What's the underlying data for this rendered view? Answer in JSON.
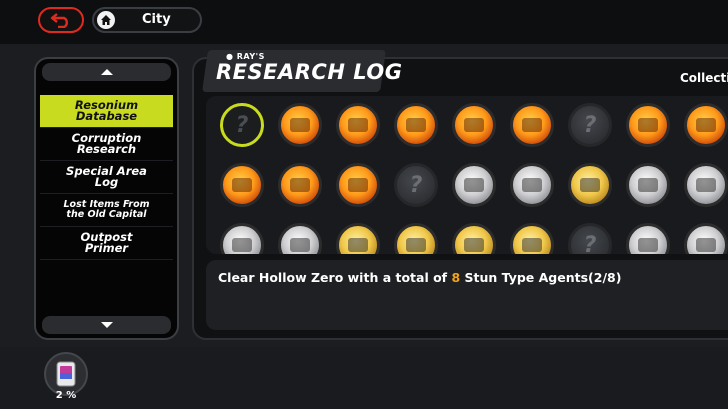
{
  "header": {
    "back_icon": "back-arrow-icon",
    "home_icon": "home-icon",
    "location": "City"
  },
  "sidebar": {
    "items": [
      {
        "label_line1": "Resonium",
        "label_line2": "Database",
        "active": true
      },
      {
        "label_line1": "Corruption",
        "label_line2": "Research",
        "active": false
      },
      {
        "label_line1": "Special Area",
        "label_line2": "Log",
        "active": false
      },
      {
        "label_line1": "Lost Items From",
        "label_line2": "the Old Capital",
        "active": false
      },
      {
        "label_line1": "Outpost",
        "label_line2": "Primer",
        "active": false
      }
    ]
  },
  "progress": {
    "percent_label": "2 %",
    "percent_value": 2
  },
  "main": {
    "brand_small": "● RAY'S",
    "title": "RESEARCH LOG",
    "collection_label": "Collection",
    "description_prefix": "Clear Hollow Zero with a total of ",
    "description_number": "8",
    "description_suffix": " Stun Type Agents(2/8)"
  },
  "medals": [
    {
      "state": "selected",
      "unknown": "?"
    },
    {
      "state": "orange"
    },
    {
      "state": "orange"
    },
    {
      "state": "orange"
    },
    {
      "state": "orange"
    },
    {
      "state": "orange"
    },
    {
      "state": "locked",
      "unknown": "?"
    },
    {
      "state": "orange"
    },
    {
      "state": "orange"
    },
    {
      "state": "orange"
    },
    {
      "state": "orange"
    },
    {
      "state": "orange"
    },
    {
      "state": "locked",
      "unknown": "?"
    },
    {
      "state": "silver"
    },
    {
      "state": "silver"
    },
    {
      "state": "gold"
    },
    {
      "state": "silver"
    },
    {
      "state": "silver"
    },
    {
      "state": "silver"
    },
    {
      "state": "silver"
    },
    {
      "state": "gold"
    },
    {
      "state": "gold"
    },
    {
      "state": "gold"
    },
    {
      "state": "gold"
    },
    {
      "state": "locked",
      "unknown": "?"
    },
    {
      "state": "silver"
    },
    {
      "state": "silver"
    }
  ],
  "colors": {
    "accent": "#c8db1f",
    "back_red": "#e02a20",
    "highlight_number": "#f0a41c"
  }
}
